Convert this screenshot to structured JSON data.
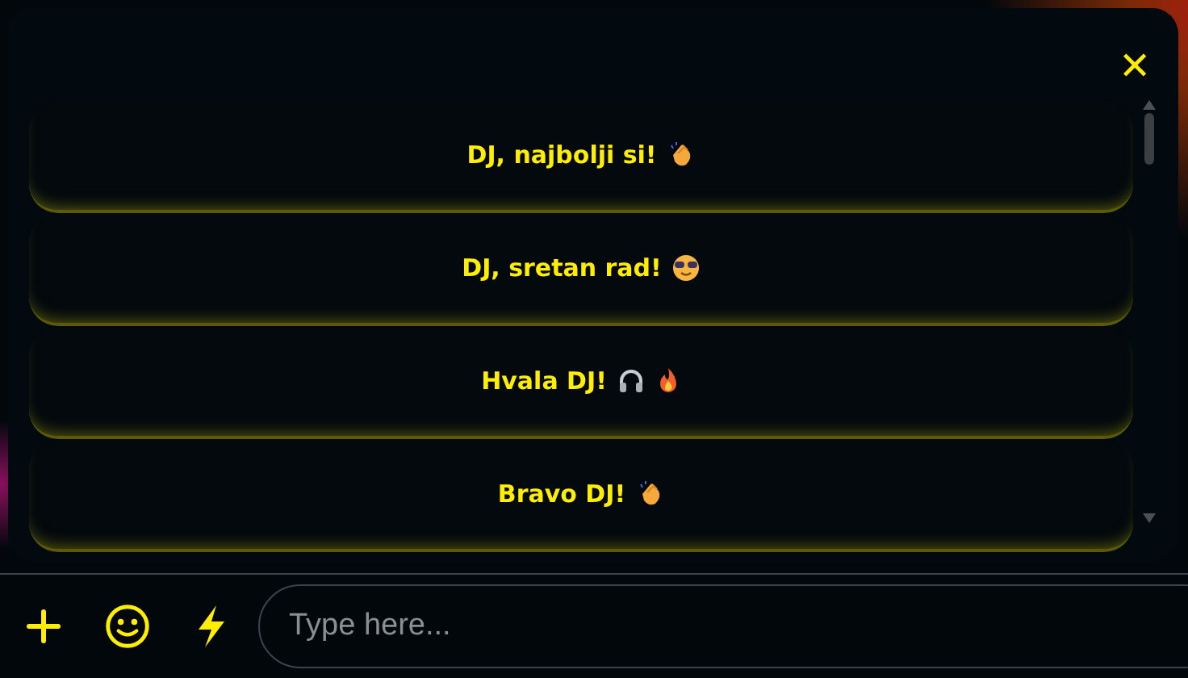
{
  "close_button": {
    "label": "✕"
  },
  "messages": [
    {
      "text": "DJ, najbolji si!",
      "emojis": [
        {
          "kind": "clap"
        }
      ]
    },
    {
      "text": "DJ, sretan rad!",
      "emojis": [
        {
          "kind": "sunglasses"
        }
      ]
    },
    {
      "text": "Hvala DJ!",
      "emojis": [
        {
          "kind": "headphones"
        },
        {
          "kind": "fire"
        }
      ]
    },
    {
      "text": "Bravo DJ!",
      "emojis": [
        {
          "kind": "clap"
        }
      ]
    }
  ],
  "input": {
    "placeholder": "Type here..."
  }
}
